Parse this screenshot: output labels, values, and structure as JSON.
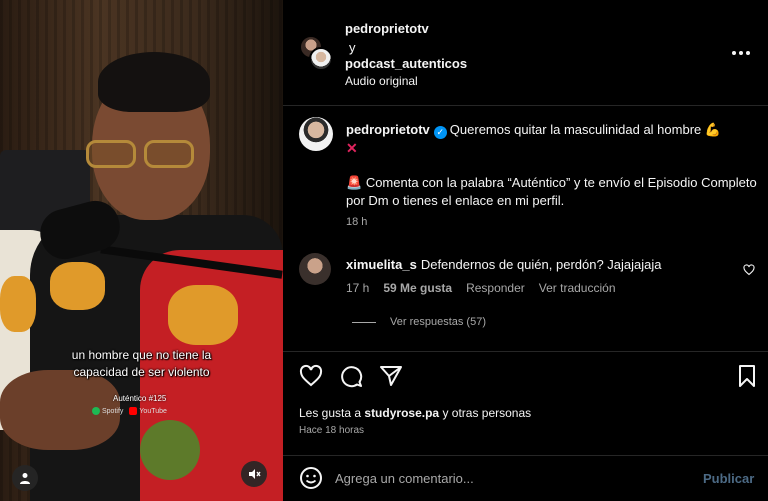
{
  "video": {
    "caption_line1": "un hombre que no tiene la",
    "caption_line2": "capacidad de ser violento",
    "episode_label": "Auténtico #125",
    "brand_spotify": "Spotify",
    "brand_youtube": "YouTube"
  },
  "header": {
    "user1": "pedroprietotv",
    "connector": "y",
    "user2": "podcast_autenticos",
    "audio": "Audio original"
  },
  "caption": {
    "username": "pedroprietotv",
    "text": "Queremos quitar la masculinidad al hombre",
    "line2": "Comenta con la palabra “Auténtico” y te envío el Episodio Completo por Dm o tienes el enlace en mi perfil.",
    "time": "18 h"
  },
  "comment": {
    "username": "ximuelita_s",
    "text": "Defendernos de quién, perdón? Jajajajaja",
    "time": "17 h",
    "likes": "59 Me gusta",
    "reply": "Responder",
    "translate": "Ver traducción",
    "view_replies": "Ver respuestas (57)"
  },
  "stats": {
    "likes_prefix": "Les gusta a",
    "likes_user": "studyrose.pa",
    "likes_suffix": "y otras personas",
    "ago": "Hace 18 horas"
  },
  "composer": {
    "placeholder": "Agrega un comentario...",
    "post": "Publicar"
  },
  "icons": {
    "like": "heart-icon",
    "comment": "comment-icon",
    "share": "send-icon",
    "save": "bookmark-icon",
    "emoji": "emoji-icon",
    "more": "more-icon",
    "user": "user-icon",
    "mute": "mute-icon",
    "verified": "verified-badge-icon"
  },
  "colors": {
    "background": "#000000",
    "text": "#f5f5f5",
    "muted": "#a8a8a8",
    "verified": "#0095f6",
    "post_disabled": "#4c6a85"
  }
}
